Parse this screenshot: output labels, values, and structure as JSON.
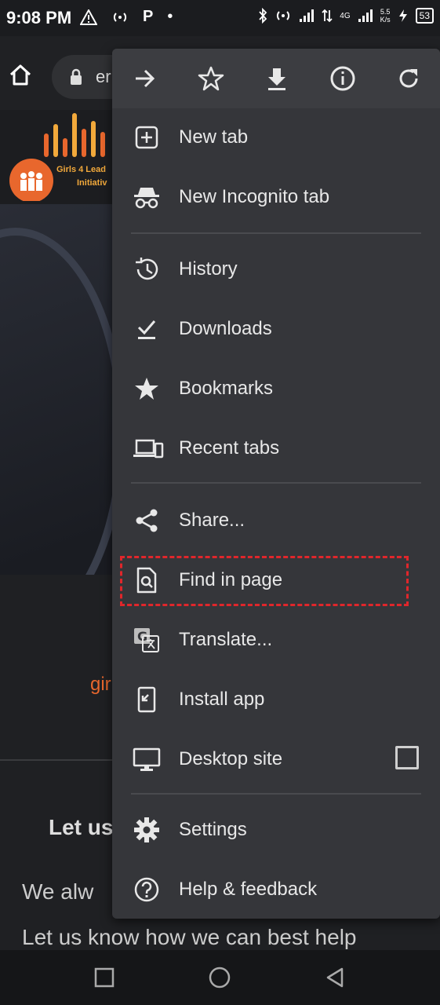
{
  "status_bar": {
    "time": "9:08 PM",
    "speed_top": "5.5",
    "speed_bottom": "K/s",
    "battery": "53",
    "network": "4G",
    "notif_p": "P",
    "notif_dot": "•"
  },
  "toolbar": {
    "url_fragment": "er"
  },
  "page": {
    "logo_line1": "Girls 4 Lead",
    "logo_line2": "Initiativ",
    "orange_text": "gir",
    "contact_heading": "Let us",
    "contact_line1": "We alw",
    "contact_line2": "Let us know how we can best help"
  },
  "menu": {
    "top_icons": [
      "forward-icon",
      "star-icon",
      "download-icon",
      "info-icon",
      "refresh-icon"
    ],
    "items": [
      {
        "label": "New tab",
        "icon": "new-tab-icon"
      },
      {
        "label": "New Incognito tab",
        "icon": "incognito-icon"
      },
      {
        "label": "History",
        "icon": "history-icon"
      },
      {
        "label": "Downloads",
        "icon": "downloads-icon"
      },
      {
        "label": "Bookmarks",
        "icon": "bookmarks-icon"
      },
      {
        "label": "Recent tabs",
        "icon": "recent-tabs-icon"
      },
      {
        "label": "Share...",
        "icon": "share-icon"
      },
      {
        "label": "Find in page",
        "icon": "find-in-page-icon"
      },
      {
        "label": "Translate...",
        "icon": "translate-icon"
      },
      {
        "label": "Install app",
        "icon": "install-app-icon"
      },
      {
        "label": "Desktop site",
        "icon": "desktop-site-icon",
        "checked": false
      },
      {
        "label": "Settings",
        "icon": "settings-icon"
      },
      {
        "label": "Help & feedback",
        "icon": "help-icon"
      }
    ]
  },
  "colors": {
    "menu_bg": "#35363a",
    "highlight": "#e0262b",
    "accent_orange": "#e8672d"
  }
}
